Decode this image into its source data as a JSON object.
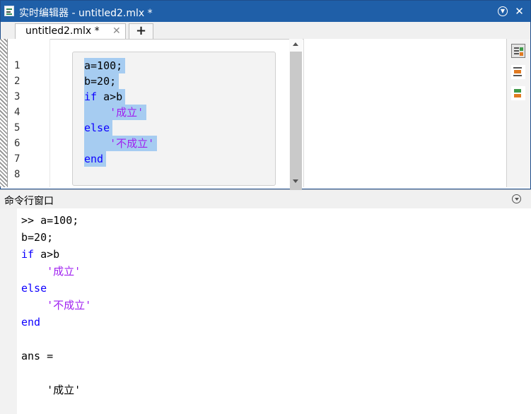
{
  "window": {
    "title": "实时编辑器 - untitled2.mlx *",
    "close_glyph": "✕",
    "menu_glyph": "▼"
  },
  "tabs": [
    {
      "label": "untitled2.mlx *",
      "close_glyph": "✕"
    }
  ],
  "add_tab_glyph": "+",
  "editor": {
    "line_numbers": [
      "1",
      "2",
      "3",
      "4",
      "5",
      "6",
      "7",
      "8"
    ],
    "code_lines": [
      {
        "segments": [
          {
            "text": "a=100;",
            "kind": "plain"
          }
        ]
      },
      {
        "segments": [
          {
            "text": "b=20;",
            "kind": "plain"
          }
        ]
      },
      {
        "segments": [
          {
            "text": "if",
            "kind": "keyword"
          },
          {
            "text": " a>b",
            "kind": "plain"
          }
        ]
      },
      {
        "segments": [
          {
            "text": "    ",
            "kind": "plain"
          },
          {
            "text": "'成立'",
            "kind": "string"
          }
        ]
      },
      {
        "segments": [
          {
            "text": "else",
            "kind": "keyword"
          }
        ]
      },
      {
        "segments": [
          {
            "text": "    ",
            "kind": "plain"
          },
          {
            "text": "'不成立'",
            "kind": "string"
          }
        ]
      },
      {
        "segments": [
          {
            "text": "end",
            "kind": "keyword"
          }
        ]
      }
    ],
    "side_tools": [
      "output-on-right-icon",
      "output-inline-icon",
      "hide-code-icon"
    ]
  },
  "command_window": {
    "title": "命令行窗口",
    "lines": [
      {
        "segments": [
          {
            "text": ">> a=100;",
            "kind": "plain"
          }
        ]
      },
      {
        "segments": [
          {
            "text": "b=20;",
            "kind": "plain"
          }
        ]
      },
      {
        "segments": [
          {
            "text": "if",
            "kind": "keyword"
          },
          {
            "text": " a>b",
            "kind": "plain"
          }
        ]
      },
      {
        "segments": [
          {
            "text": "    ",
            "kind": "plain"
          },
          {
            "text": "'成立'",
            "kind": "string"
          }
        ]
      },
      {
        "segments": [
          {
            "text": "else",
            "kind": "keyword"
          }
        ]
      },
      {
        "segments": [
          {
            "text": "    ",
            "kind": "plain"
          },
          {
            "text": "'不成立'",
            "kind": "string"
          }
        ]
      },
      {
        "segments": [
          {
            "text": "end",
            "kind": "keyword"
          }
        ]
      },
      {
        "segments": [
          {
            "text": "",
            "kind": "plain"
          }
        ]
      },
      {
        "segments": [
          {
            "text": "ans =",
            "kind": "plain"
          }
        ]
      },
      {
        "segments": [
          {
            "text": "",
            "kind": "plain"
          }
        ]
      },
      {
        "segments": [
          {
            "text": "    '成立'",
            "kind": "plain"
          }
        ]
      }
    ]
  },
  "colors": {
    "titlebar": "#1f5fa8",
    "selection": "#a6ccf1",
    "keyword": "#0e00ff",
    "string": "#a020f0"
  }
}
